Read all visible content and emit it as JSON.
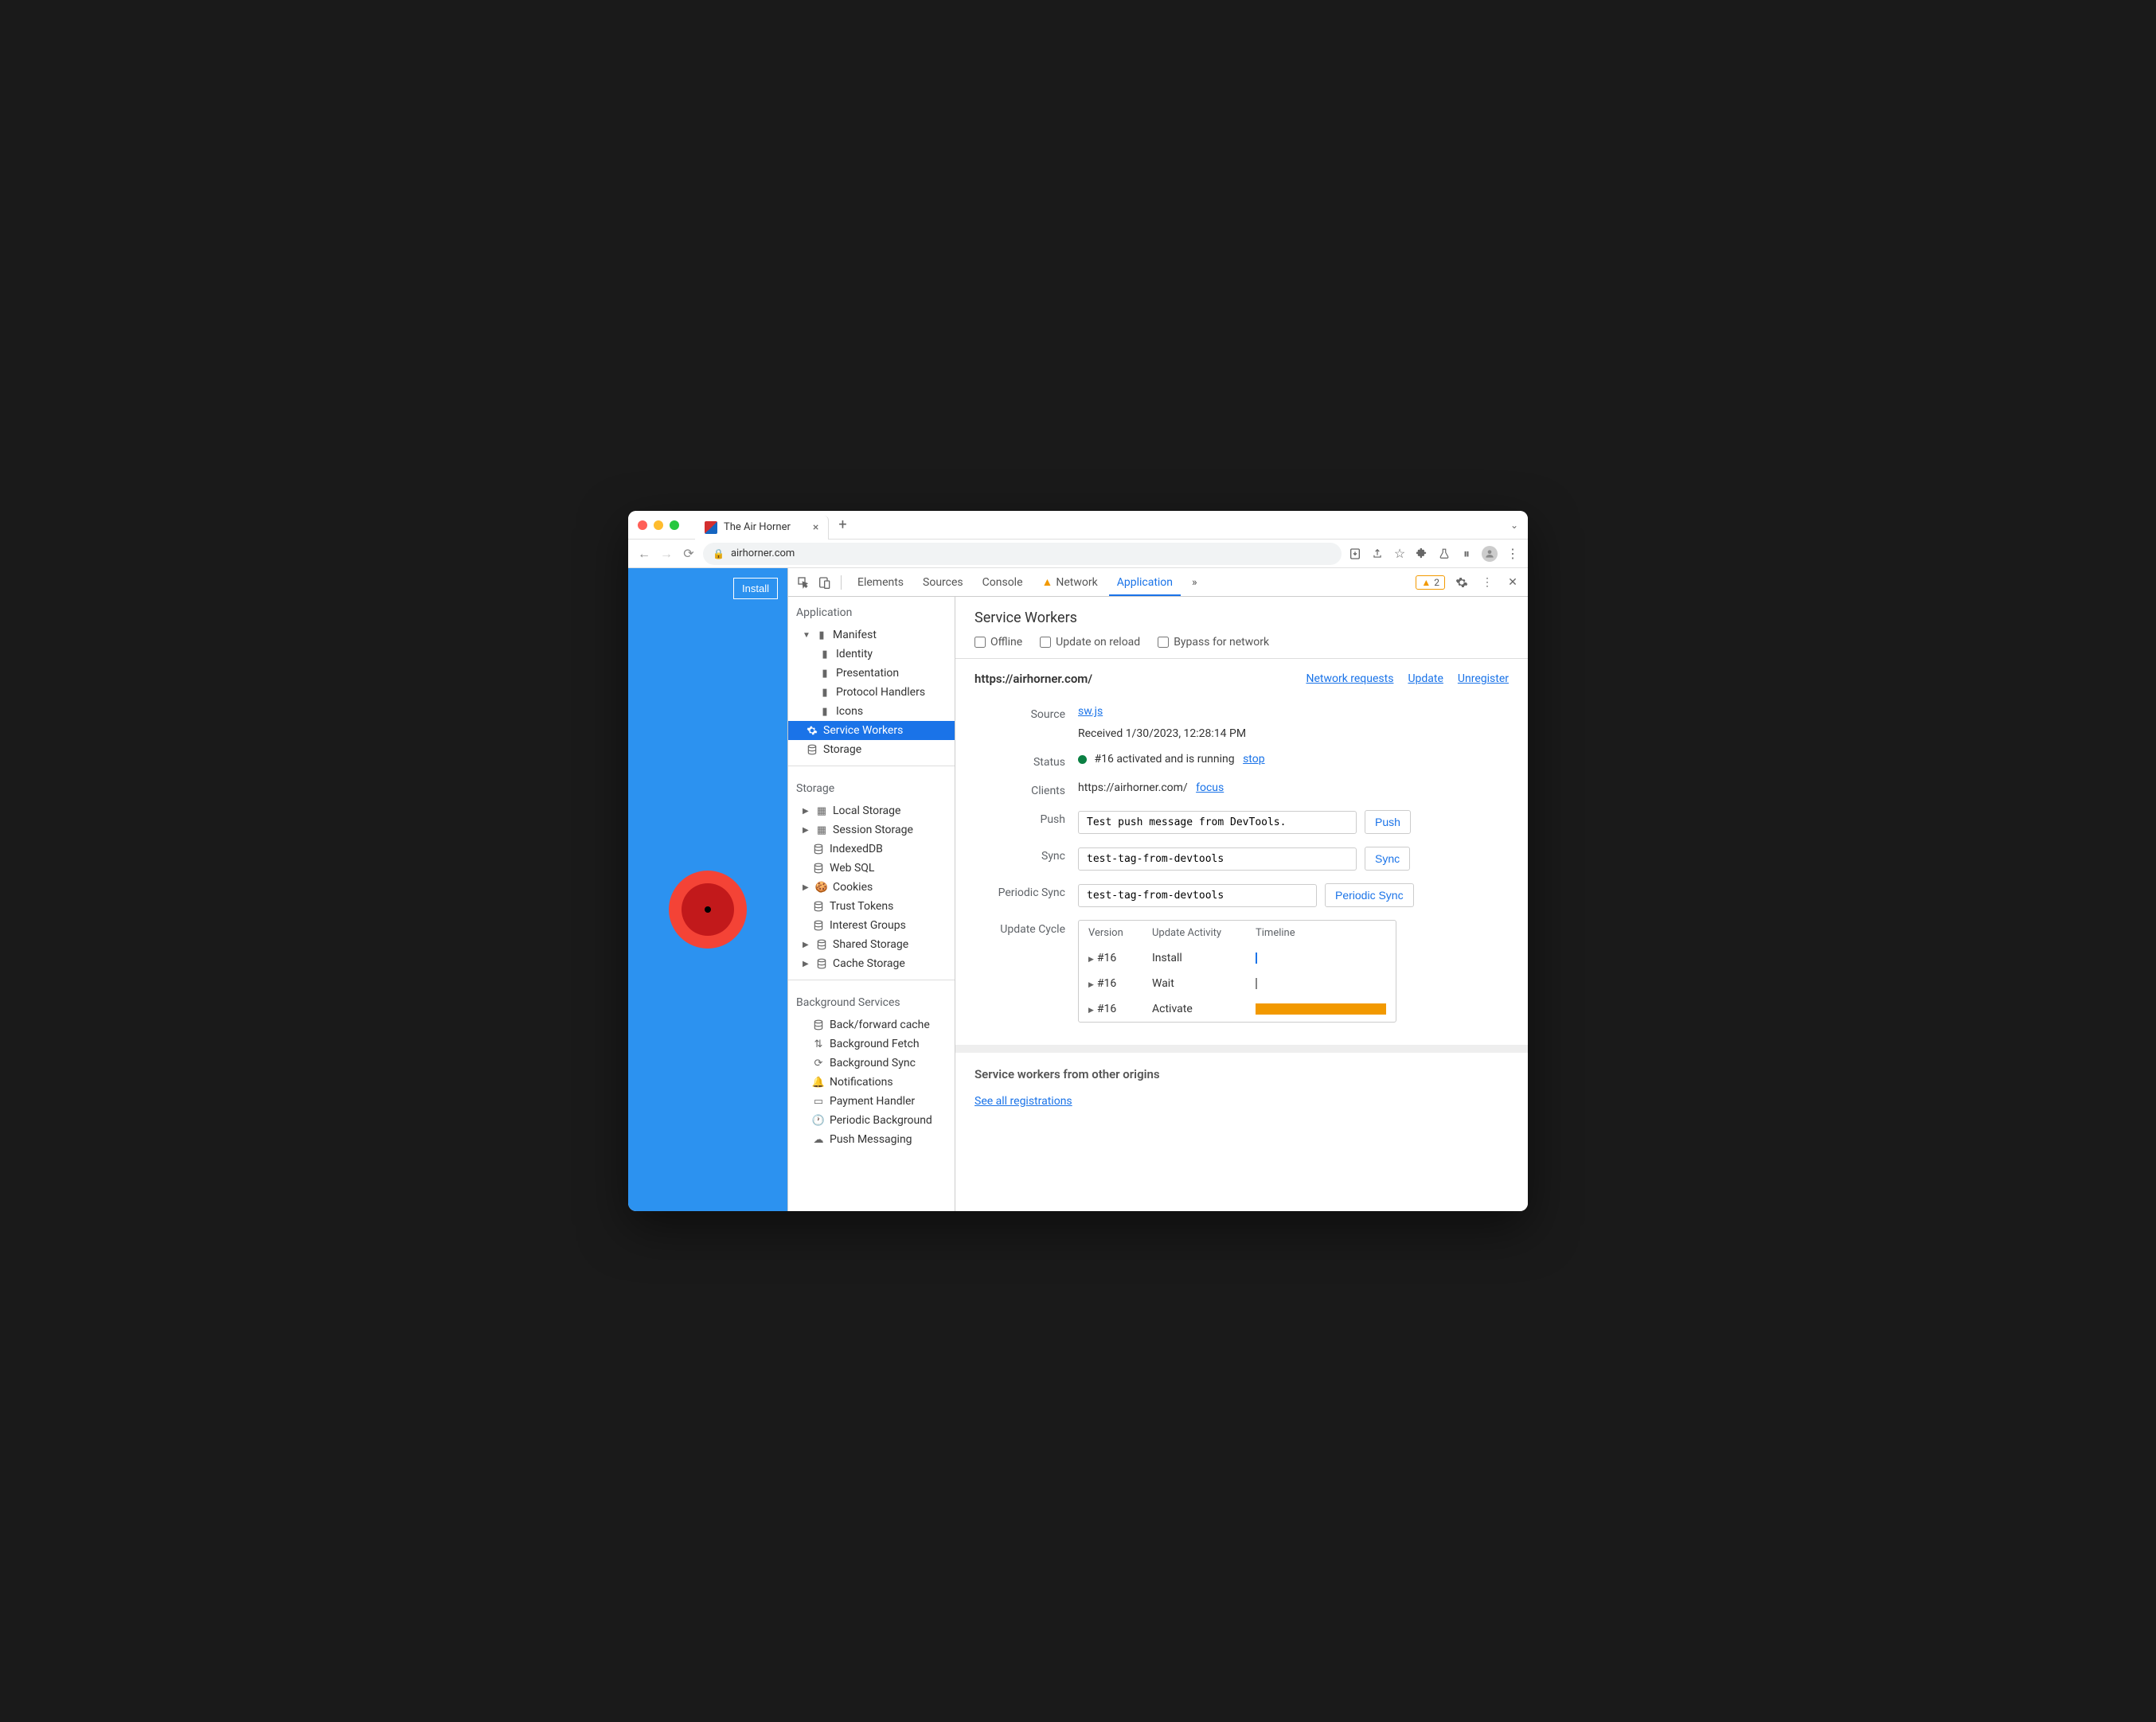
{
  "tab": {
    "title": "The Air Horner"
  },
  "url": "airhorner.com",
  "install_label": "Install",
  "devtools": {
    "tabs": [
      "Elements",
      "Sources",
      "Console",
      "Network",
      "Application"
    ],
    "warning_count": "2"
  },
  "sidebar": {
    "application": {
      "title": "Application",
      "manifest": "Manifest",
      "identity": "Identity",
      "presentation": "Presentation",
      "protocol": "Protocol Handlers",
      "icons": "Icons",
      "service_workers": "Service Workers",
      "storage": "Storage"
    },
    "storage": {
      "title": "Storage",
      "local": "Local Storage",
      "session": "Session Storage",
      "indexed": "IndexedDB",
      "websql": "Web SQL",
      "cookies": "Cookies",
      "trust": "Trust Tokens",
      "interest": "Interest Groups",
      "shared": "Shared Storage",
      "cache": "Cache Storage"
    },
    "background": {
      "title": "Background Services",
      "bfcache": "Back/forward cache",
      "bgfetch": "Background Fetch",
      "bgsync": "Background Sync",
      "notif": "Notifications",
      "payment": "Payment Handler",
      "periodic": "Periodic Background",
      "push": "Push Messaging"
    }
  },
  "main": {
    "title": "Service Workers",
    "offline": "Offline",
    "update_reload": "Update on reload",
    "bypass": "Bypass for network",
    "scope": "https://airhorner.com/",
    "links": {
      "network": "Network requests",
      "update": "Update",
      "unregister": "Unregister"
    },
    "source": {
      "label": "Source",
      "file": "sw.js",
      "received": "Received 1/30/2023, 12:28:14 PM"
    },
    "status": {
      "label": "Status",
      "text": "#16 activated and is running",
      "stop": "stop"
    },
    "clients": {
      "label": "Clients",
      "url": "https://airhorner.com/",
      "focus": "focus"
    },
    "push": {
      "label": "Push",
      "value": "Test push message from DevTools.",
      "btn": "Push"
    },
    "sync": {
      "label": "Sync",
      "value": "test-tag-from-devtools",
      "btn": "Sync"
    },
    "periodic": {
      "label": "Periodic Sync",
      "value": "test-tag-from-devtools",
      "btn": "Periodic Sync"
    },
    "cycle": {
      "label": "Update Cycle",
      "headers": {
        "version": "Version",
        "activity": "Update Activity",
        "timeline": "Timeline"
      },
      "rows": [
        {
          "version": "#16",
          "activity": "Install"
        },
        {
          "version": "#16",
          "activity": "Wait"
        },
        {
          "version": "#16",
          "activity": "Activate"
        }
      ]
    },
    "other": {
      "title": "Service workers from other origins",
      "link": "See all registrations"
    }
  }
}
